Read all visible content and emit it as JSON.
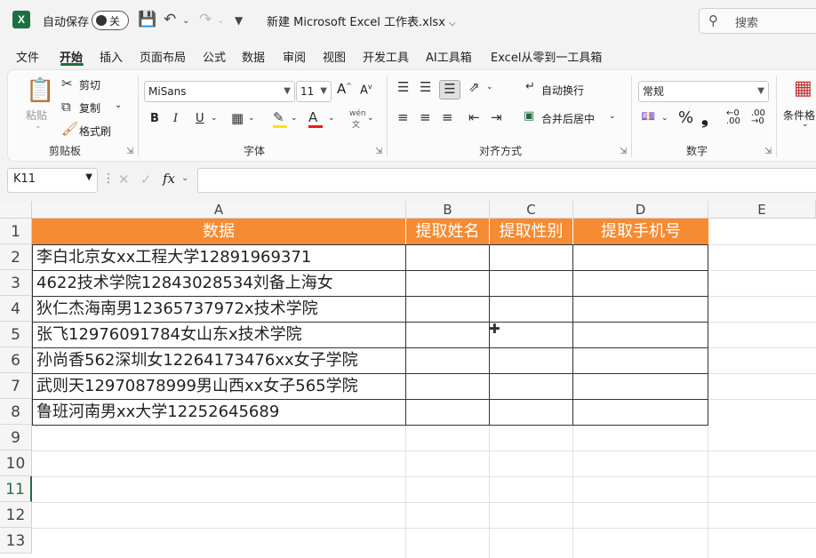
{
  "titlebar": {
    "autosave_label": "自动保存",
    "autosave_state": "关",
    "filename": "新建 Microsoft Excel 工作表.xlsx",
    "search_placeholder": "搜索"
  },
  "menu": {
    "tabs": [
      "文件",
      "开始",
      "插入",
      "页面布局",
      "公式",
      "数据",
      "审阅",
      "视图",
      "开发工具",
      "AI工具箱",
      "Excel从零到一工具箱"
    ],
    "active": "开始"
  },
  "ribbon": {
    "clipboard": {
      "paste": "粘贴",
      "cut": "剪切",
      "copy": "复制",
      "format_painter": "格式刷",
      "label": "剪贴板"
    },
    "font": {
      "name": "MiSans",
      "size": "11",
      "bold": "B",
      "italic": "I",
      "underline": "U",
      "label": "字体"
    },
    "alignment": {
      "wrap": "自动换行",
      "merge": "合并后居中",
      "label": "对齐方式"
    },
    "number": {
      "format": "常规",
      "percent": "%",
      "comma": "❟",
      "label": "数字"
    },
    "styles": {
      "conditional": "条件格"
    }
  },
  "formula_bar": {
    "name_box": "K11",
    "fx": "fx",
    "value": ""
  },
  "sheet": {
    "columns": [
      "A",
      "B",
      "C",
      "D",
      "E"
    ],
    "rows": [
      "1",
      "2",
      "3",
      "4",
      "5",
      "6",
      "7",
      "8",
      "9",
      "10",
      "11",
      "12",
      "13"
    ],
    "selected_row": "11",
    "header": [
      "数据",
      "提取姓名",
      "提取性别",
      "提取手机号"
    ],
    "data": [
      "李白北京女xx工程大学12891969371",
      "4622技术学院12843028534刘备上海女",
      "狄仁杰海南男12365737972x技术学院",
      "张飞12976091784女山东x技术学院",
      "孙尚香562深圳女12264173476xx女子学院",
      "武则天12970878999男山西xx女子565学院",
      "鲁班河南男xx大学12252645689"
    ],
    "header_color": "#f58b32"
  }
}
